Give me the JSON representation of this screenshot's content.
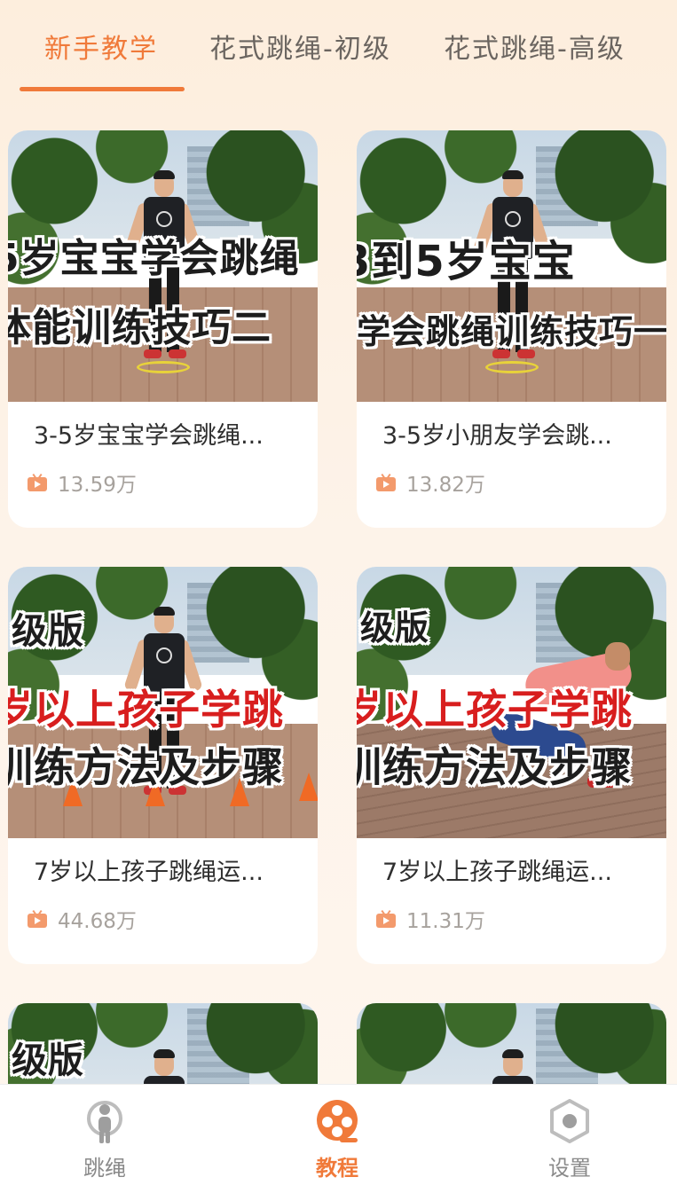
{
  "tabs": [
    {
      "label": "新手教学",
      "active": true
    },
    {
      "label": "花式跳绳-初级",
      "active": false
    },
    {
      "label": "花式跳绳-高级",
      "active": false
    }
  ],
  "cards": [
    {
      "title": "3-5岁宝宝学会跳绳...",
      "views": "13.59万",
      "overlay": [
        "5岁宝宝学会跳绳",
        "体能训练技巧二"
      ]
    },
    {
      "title": "3-5岁小朋友学会跳...",
      "views": "13.82万",
      "overlay": [
        "3到5岁宝宝",
        "学会跳绳训练技巧一"
      ]
    },
    {
      "title": "7岁以上孩子跳绳运...",
      "views": "44.68万",
      "overlay": [
        "级版",
        "岁以上孩子学跳",
        "训练方法及步骤"
      ]
    },
    {
      "title": "7岁以上孩子跳绳运...",
      "views": "11.31万",
      "overlay": [
        "级版",
        "岁以上孩子学跳",
        "训练方法及步骤"
      ]
    },
    {
      "overlay": [
        "级版"
      ]
    },
    {
      "overlay": []
    }
  ],
  "bottom_nav": [
    {
      "label": "跳绳",
      "icon": "person-icon",
      "active": false
    },
    {
      "label": "教程",
      "icon": "film-reel-icon",
      "active": true
    },
    {
      "label": "设置",
      "icon": "settings-hexagon-icon",
      "active": false
    }
  ],
  "colors": {
    "accent": "#f07a3a",
    "background": "#fdf1e4",
    "view_icon": "#f39a6c"
  }
}
